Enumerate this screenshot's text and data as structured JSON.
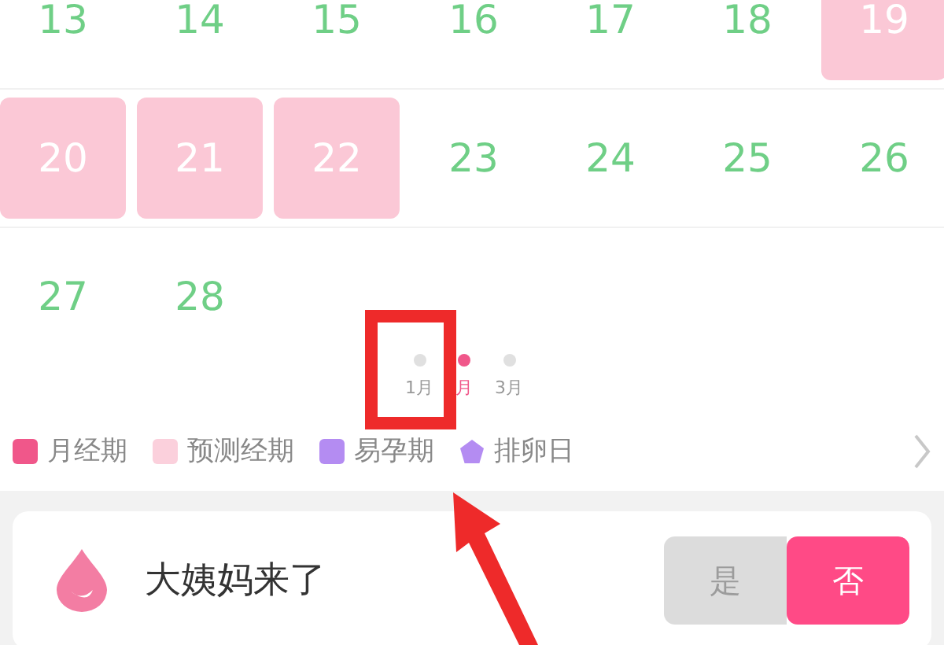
{
  "calendar": {
    "weeks": [
      [
        {
          "day": "13",
          "kind": "normal"
        },
        {
          "day": "14",
          "kind": "normal"
        },
        {
          "day": "15",
          "kind": "normal"
        },
        {
          "day": "16",
          "kind": "normal"
        },
        {
          "day": "17",
          "kind": "normal"
        },
        {
          "day": "18",
          "kind": "normal"
        },
        {
          "day": "19",
          "kind": "predicted"
        }
      ],
      [
        {
          "day": "20",
          "kind": "predicted"
        },
        {
          "day": "21",
          "kind": "predicted"
        },
        {
          "day": "22",
          "kind": "predicted"
        },
        {
          "day": "23",
          "kind": "normal"
        },
        {
          "day": "24",
          "kind": "normal"
        },
        {
          "day": "25",
          "kind": "normal"
        },
        {
          "day": "26",
          "kind": "normal"
        }
      ],
      [
        {
          "day": "27",
          "kind": "normal"
        },
        {
          "day": "28",
          "kind": "normal"
        }
      ]
    ]
  },
  "months": [
    {
      "label": "1月",
      "selected": false
    },
    {
      "label": "月",
      "selected": true
    },
    {
      "label": "3月",
      "selected": false
    }
  ],
  "legend": [
    {
      "label": "月经期",
      "kind": "square",
      "color": "#f0578a"
    },
    {
      "label": "预测经期",
      "kind": "square",
      "color": "#fbd0dc"
    },
    {
      "label": "易孕期",
      "kind": "square",
      "color": "#b48cf2"
    },
    {
      "label": "排卵日",
      "kind": "pentagon",
      "color": "#b48cf2"
    }
  ],
  "period_card": {
    "title": "大姨妈来了",
    "options": [
      {
        "label": "是",
        "selected": false
      },
      {
        "label": "否",
        "selected": true
      }
    ]
  },
  "annotations": {
    "highlight_box": true,
    "arrow": true
  }
}
